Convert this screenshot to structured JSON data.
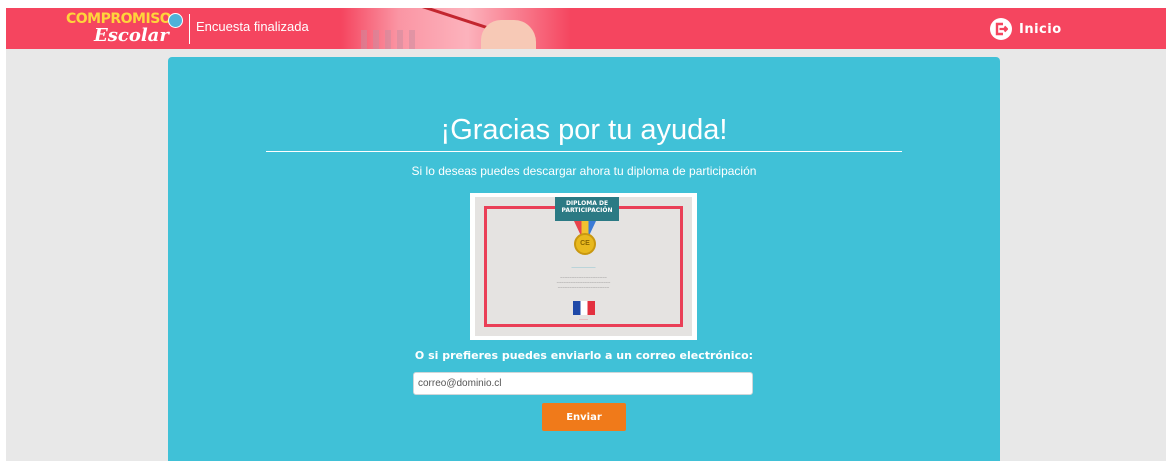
{
  "header": {
    "logo_top": "COMPROMISO",
    "logo_bottom": "Escolar",
    "section_title": "Encuesta finalizada",
    "inicio_label": "Inicio",
    "inicio_icon": "logout-icon"
  },
  "main": {
    "heading": "¡Gracias por tu ayuda!",
    "subtitle": "Si lo deseas puedes descargar ahora tu diploma de participación",
    "diploma": {
      "ribbon_text": "DIPLOMA DE PARTICIPACIÓN"
    },
    "email_prompt": "O si prefieres puedes enviarlo a un correo electrónico:",
    "email_value": "correo@dominio.cl",
    "send_label": "Enviar"
  },
  "colors": {
    "topbar": "#f5455f",
    "card": "#40c1d7",
    "button": "#f07a1a",
    "logo_yellow": "#ffd43b"
  }
}
